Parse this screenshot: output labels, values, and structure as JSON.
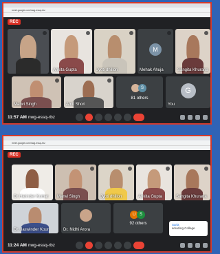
{
  "colors": {
    "background": "#2f63b6",
    "frame": "#d33a2c",
    "meet_bg": "#202124"
  },
  "shot1": {
    "rec": "REC",
    "url": "meet.google.com/nwg-essq-rbz",
    "tiles": [
      {
        "name": "",
        "type": "video"
      },
      {
        "name": "Ankita Gupta",
        "type": "video"
      },
      {
        "name": "Jyoti dhillon",
        "type": "video"
      },
      {
        "name": "Mehak Ahuja",
        "type": "avatar",
        "initial": "M"
      },
      {
        "name": "Sangita Khurana",
        "type": "video"
      },
      {
        "name": "Manvi Singh",
        "type": "video"
      },
      {
        "name": "Amit Shori",
        "type": "video"
      },
      {
        "name": "81 others",
        "type": "others",
        "initial": "S"
      },
      {
        "name": "You",
        "type": "avatar",
        "initial": "G"
      }
    ],
    "time": "11:57 AM",
    "code": "nwg-essq-rbz"
  },
  "shot2": {
    "rec": "REC",
    "url": "meet.google.com/nwg-essq-rbz",
    "tiles": [
      {
        "name": "Dr Harinder Kumar",
        "type": "video"
      },
      {
        "name": "Manvi Singh",
        "type": "video"
      },
      {
        "name": "Jyoti dhillon",
        "type": "video"
      },
      {
        "name": "Ankita Gupta",
        "type": "video"
      },
      {
        "name": "Sangita Khurana",
        "type": "video"
      },
      {
        "name": "Dr. Jaswinder Kour",
        "type": "video"
      },
      {
        "name": "Dr. Nidhi Arora",
        "type": "video"
      },
      {
        "name": "92 others",
        "type": "others",
        "initial": "U S"
      },
      {
        "name": "",
        "type": "toast"
      }
    ],
    "toast_title": "Sarla",
    "toast_text": "amazing College",
    "time": "11:24 AM",
    "code": "nwg-essq-rbz"
  }
}
